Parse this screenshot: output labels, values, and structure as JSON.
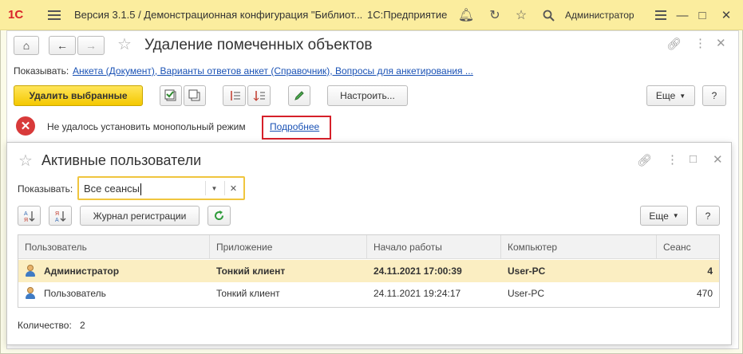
{
  "titlebar": {
    "logo": "1С",
    "title": "Версия 3.1.5 / Демонстрационная конфигурация \"Библиот...",
    "app": "1С:Предприятие",
    "user": "Администратор"
  },
  "main": {
    "title": "Удаление помеченных объектов",
    "show_label": "Показывать:",
    "show_link": "Анкета (Документ), Варианты ответов анкет (Справочник), Вопросы для анкетирования ...",
    "delete_button": "Удалить выбранные",
    "configure_button": "Настроить...",
    "more_button": "Еще",
    "help_button": "?",
    "error_message": "Не удалось установить монопольный режим",
    "details_link": "Подробнее"
  },
  "modal": {
    "title": "Активные пользователи",
    "show_label": "Показывать:",
    "filter_value": "Все сеансы",
    "journal_button": "Журнал регистрации",
    "more_button": "Еще",
    "help_button": "?",
    "columns": [
      "Пользователь",
      "Приложение",
      "Начало работы",
      "Компьютер",
      "Сеанс"
    ],
    "rows": [
      {
        "user": "Администратор",
        "app": "Тонкий клиент",
        "start": "24.11.2021 17:00:39",
        "computer": "User-PC",
        "session": "4"
      },
      {
        "user": "Пользователь",
        "app": "Тонкий клиент",
        "start": "24.11.2021 19:24:17",
        "computer": "User-PC",
        "session": "470"
      }
    ],
    "count_label": "Количество:",
    "count_value": "2"
  },
  "colors": {
    "titlebar_bg": "#fbed9e",
    "accent_yellow": "#f4c800",
    "error_red": "#d83a3a",
    "link_blue": "#1a52b5",
    "selected_row": "#fbeec2"
  }
}
